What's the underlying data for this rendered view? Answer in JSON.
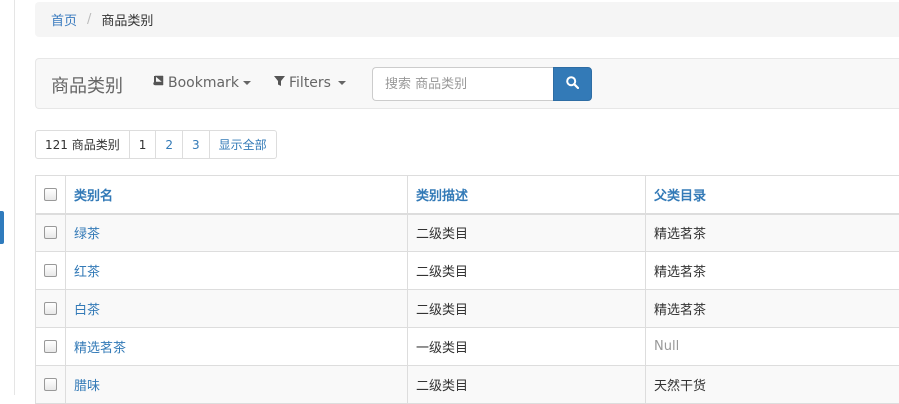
{
  "breadcrumb": {
    "home": "首页",
    "separator": "/",
    "current": "商品类别"
  },
  "toolbar": {
    "brand": "商品类别",
    "bookmark_label": "Bookmark",
    "filters_label": "Filters",
    "search_placeholder": "搜索 商品类别"
  },
  "pagination": {
    "count_label": "121 商品类别",
    "pages": [
      "1",
      "2",
      "3"
    ],
    "current_page": "1",
    "show_all": "显示全部"
  },
  "table": {
    "columns": [
      "类别名",
      "类别描述",
      "父类目录"
    ],
    "rows": [
      {
        "name": "绿茶",
        "desc": "二级类目",
        "parent": "精选茗茶"
      },
      {
        "name": "红茶",
        "desc": "二级类目",
        "parent": "精选茗茶"
      },
      {
        "name": "白茶",
        "desc": "二级类目",
        "parent": "精选茗茶"
      },
      {
        "name": "精选茗茶",
        "desc": "一级类目",
        "parent": "Null"
      },
      {
        "name": "腊味",
        "desc": "二级类目",
        "parent": "天然干货"
      }
    ]
  },
  "colors": {
    "link": "#337ab7",
    "search_button": "#337ab7",
    "active_marker": "#2f7bbd"
  },
  "icons": {
    "bookmark": "book-icon",
    "filters": "filter-icon",
    "search": "magnifier-icon"
  }
}
